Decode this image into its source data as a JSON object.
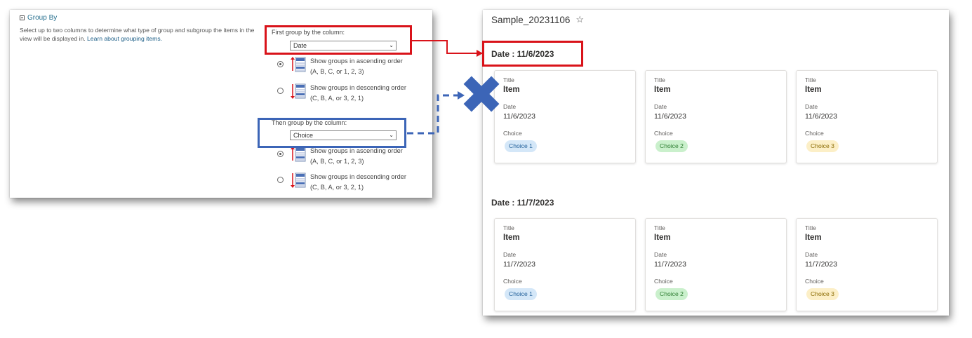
{
  "group_by": {
    "header": "Group By",
    "description": "Select up to two columns to determine what type of group and subgroup the items in the view will be displayed in.",
    "learn_link": "Learn about grouping items.",
    "first": {
      "label": "First group by the column:",
      "selected": "Date",
      "options": [
        {
          "line1": "Show groups in ascending order",
          "line2": "(A, B, C, or 1, 2, 3)",
          "checked": true
        },
        {
          "line1": "Show groups in descending order",
          "line2": "(C, B, A, or 3, 2, 1)",
          "checked": false
        }
      ]
    },
    "then": {
      "label": "Then group by the column:",
      "selected": "Choice",
      "options": [
        {
          "line1": "Show groups in ascending order",
          "line2": "(A, B, C, or 1, 2, 3)",
          "checked": true
        },
        {
          "line1": "Show groups in descending order",
          "line2": "(C, B, A, or 3, 2, 1)",
          "checked": false
        }
      ]
    }
  },
  "annotations": {
    "first_color": "#d9131a",
    "then_color": "#3c65b7",
    "x_mark_color": "#3c65b7"
  },
  "list": {
    "title": "Sample_20231106",
    "field_labels": {
      "title": "Title",
      "date": "Date",
      "choice": "Choice"
    },
    "choice_colors": {
      "Choice 1": {
        "bg": "#d4e7f8",
        "fg": "#1f5e99"
      },
      "Choice 2": {
        "bg": "#caf0cc",
        "fg": "#2e7d32"
      },
      "Choice 3": {
        "bg": "#fcefc7",
        "fg": "#8a6a00"
      }
    },
    "groups": [
      {
        "heading": "Date : 11/6/2023",
        "items": [
          {
            "title": "Item",
            "date": "11/6/2023",
            "choice": "Choice 1"
          },
          {
            "title": "Item",
            "date": "11/6/2023",
            "choice": "Choice 2"
          },
          {
            "title": "Item",
            "date": "11/6/2023",
            "choice": "Choice 3"
          }
        ]
      },
      {
        "heading": "Date : 11/7/2023",
        "items": [
          {
            "title": "Item",
            "date": "11/7/2023",
            "choice": "Choice 1"
          },
          {
            "title": "Item",
            "date": "11/7/2023",
            "choice": "Choice 2"
          },
          {
            "title": "Item",
            "date": "11/7/2023",
            "choice": "Choice 3"
          }
        ]
      }
    ]
  }
}
